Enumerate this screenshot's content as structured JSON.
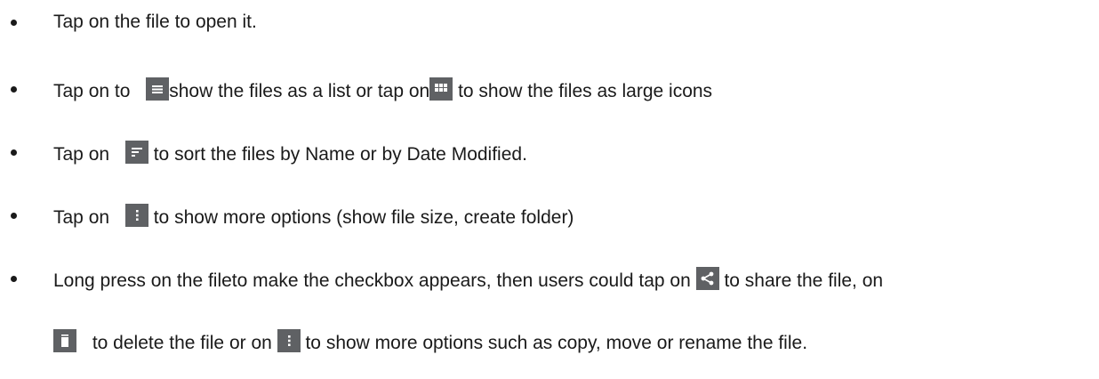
{
  "instructions": [
    {
      "text": "Tap on the file to open it."
    },
    {
      "part1": "Tap on to ",
      "icon1": "list-view-icon",
      "part2": "show the files as a list or tap on",
      "icon2": "grid-view-icon",
      "part3": " to show the files as large icons"
    },
    {
      "part1": "Tap on ",
      "icon1": "sort-icon",
      "part2": " to sort the files by Name or by Date Modified."
    },
    {
      "part1": "Tap on ",
      "icon1": "more-options-icon",
      "part2": " to show more options (show file size, create folder)"
    },
    {
      "part1": "Long press on the fileto make the checkbox appears, then users could tap on ",
      "icon1": "share-icon",
      "part2": " to share the file, on",
      "icon2": "delete-icon",
      "part3": " to delete the file or on ",
      "icon3": "more-options-icon",
      "part4": " to show more options such as copy, move or rename the file."
    }
  ],
  "colors": {
    "text": "#1a1a1a",
    "icon_background": "#5f6164",
    "icon_foreground": "#ffffff"
  }
}
